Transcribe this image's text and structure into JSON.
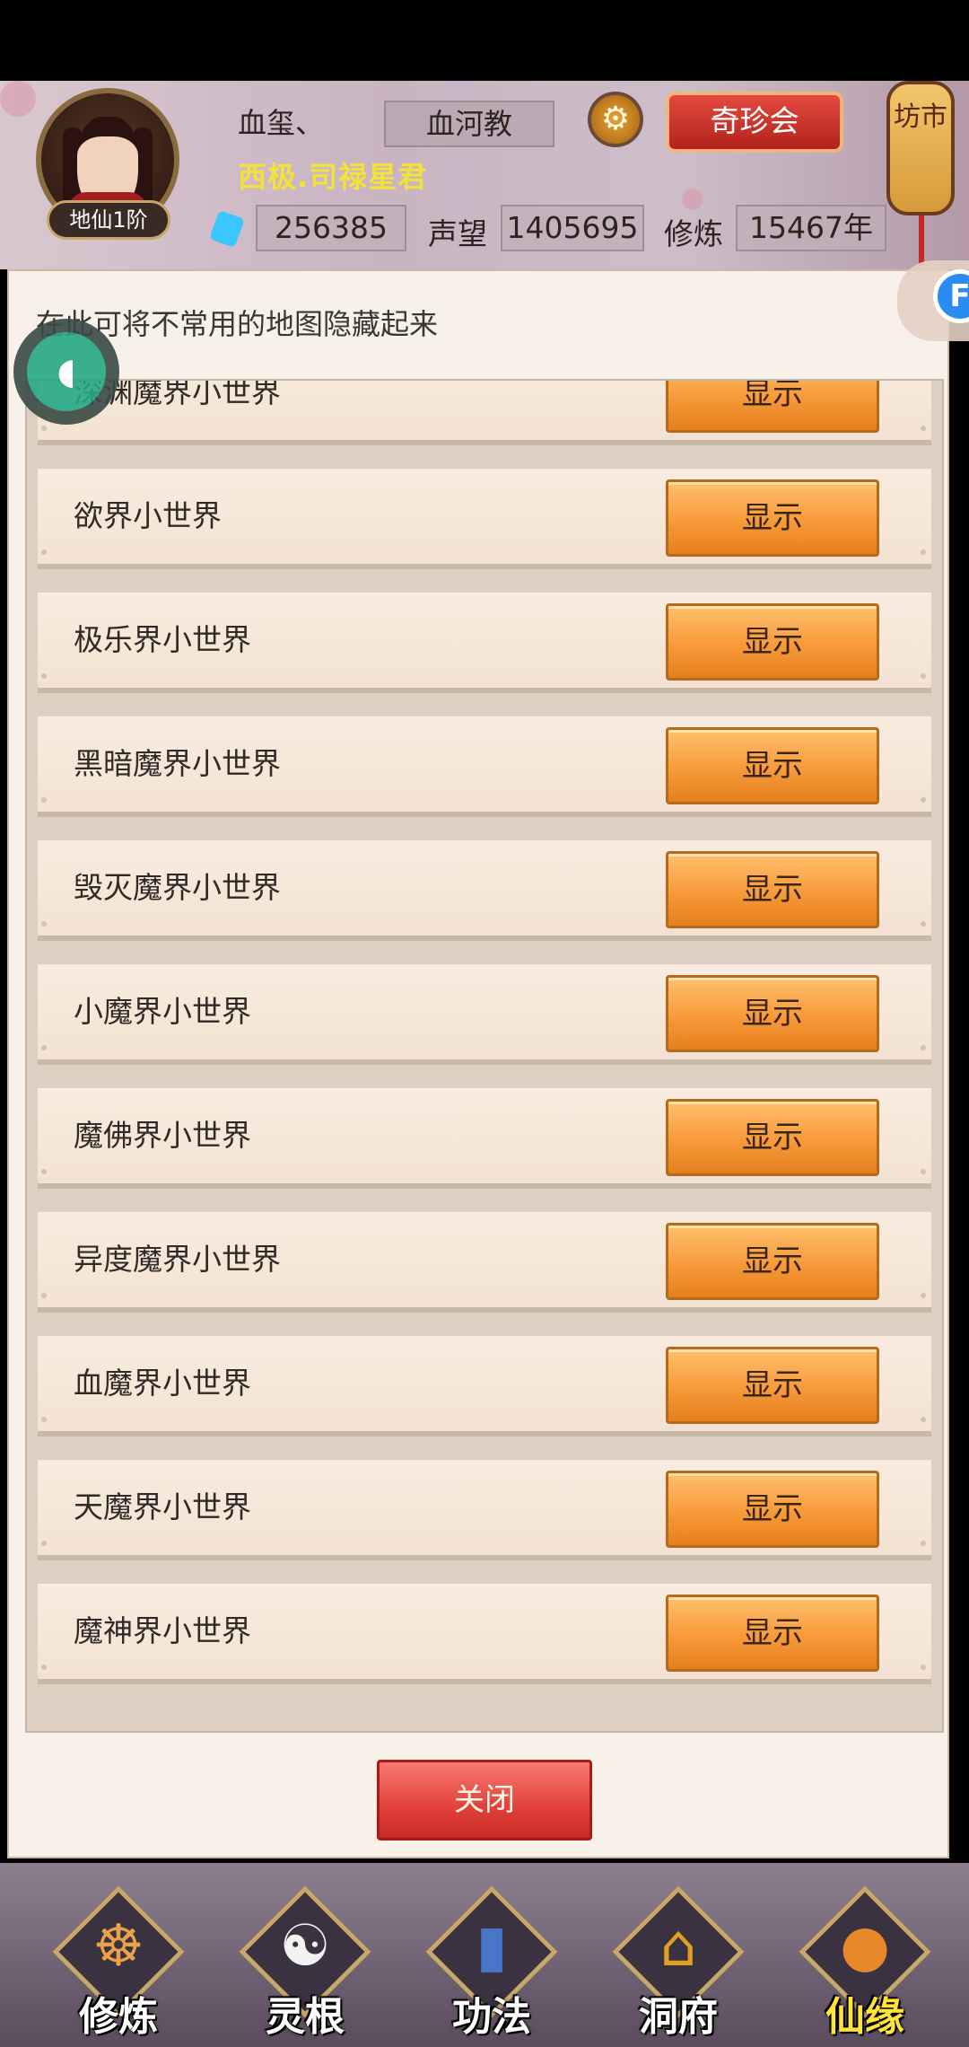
{
  "header": {
    "player_name": "血玺、",
    "player_title": "西极.司禄星君",
    "rank": "地仙1阶",
    "sect": "血河教",
    "treasure_button": "奇珍会",
    "lantern_text": "坊市",
    "stats": {
      "gems": "256385",
      "reputation_label": "声望",
      "reputation": "1405695",
      "cultivation_label": "修炼",
      "cultivation": "15467年"
    }
  },
  "dialog": {
    "hint": "在此可将不常用的地图隐藏起来",
    "rows": [
      {
        "label": "深渊魔界小世界",
        "button": "显示"
      },
      {
        "label": "欲界小世界",
        "button": "显示"
      },
      {
        "label": "极乐界小世界",
        "button": "显示"
      },
      {
        "label": "黑暗魔界小世界",
        "button": "显示"
      },
      {
        "label": "毁灭魔界小世界",
        "button": "显示"
      },
      {
        "label": "小魔界小世界",
        "button": "显示"
      },
      {
        "label": "魔佛界小世界",
        "button": "显示"
      },
      {
        "label": "异度魔界小世界",
        "button": "显示"
      },
      {
        "label": "血魔界小世界",
        "button": "显示"
      },
      {
        "label": "天魔界小世界",
        "button": "显示"
      },
      {
        "label": "魔神界小世界",
        "button": "显示"
      }
    ],
    "close_button": "关闭"
  },
  "nav": {
    "items": [
      {
        "label": "修炼",
        "icon": "meditation-icon"
      },
      {
        "label": "灵根",
        "icon": "spirit-root-icon"
      },
      {
        "label": "功法",
        "icon": "scripture-book-icon"
      },
      {
        "label": "洞府",
        "icon": "cave-dwelling-icon"
      },
      {
        "label": "仙缘",
        "icon": "gourd-icon"
      }
    ],
    "active_index": 4
  },
  "colors": {
    "show_button": "#f79a3a",
    "close_button": "#e2403a",
    "title_yellow": "#f3e23a"
  }
}
